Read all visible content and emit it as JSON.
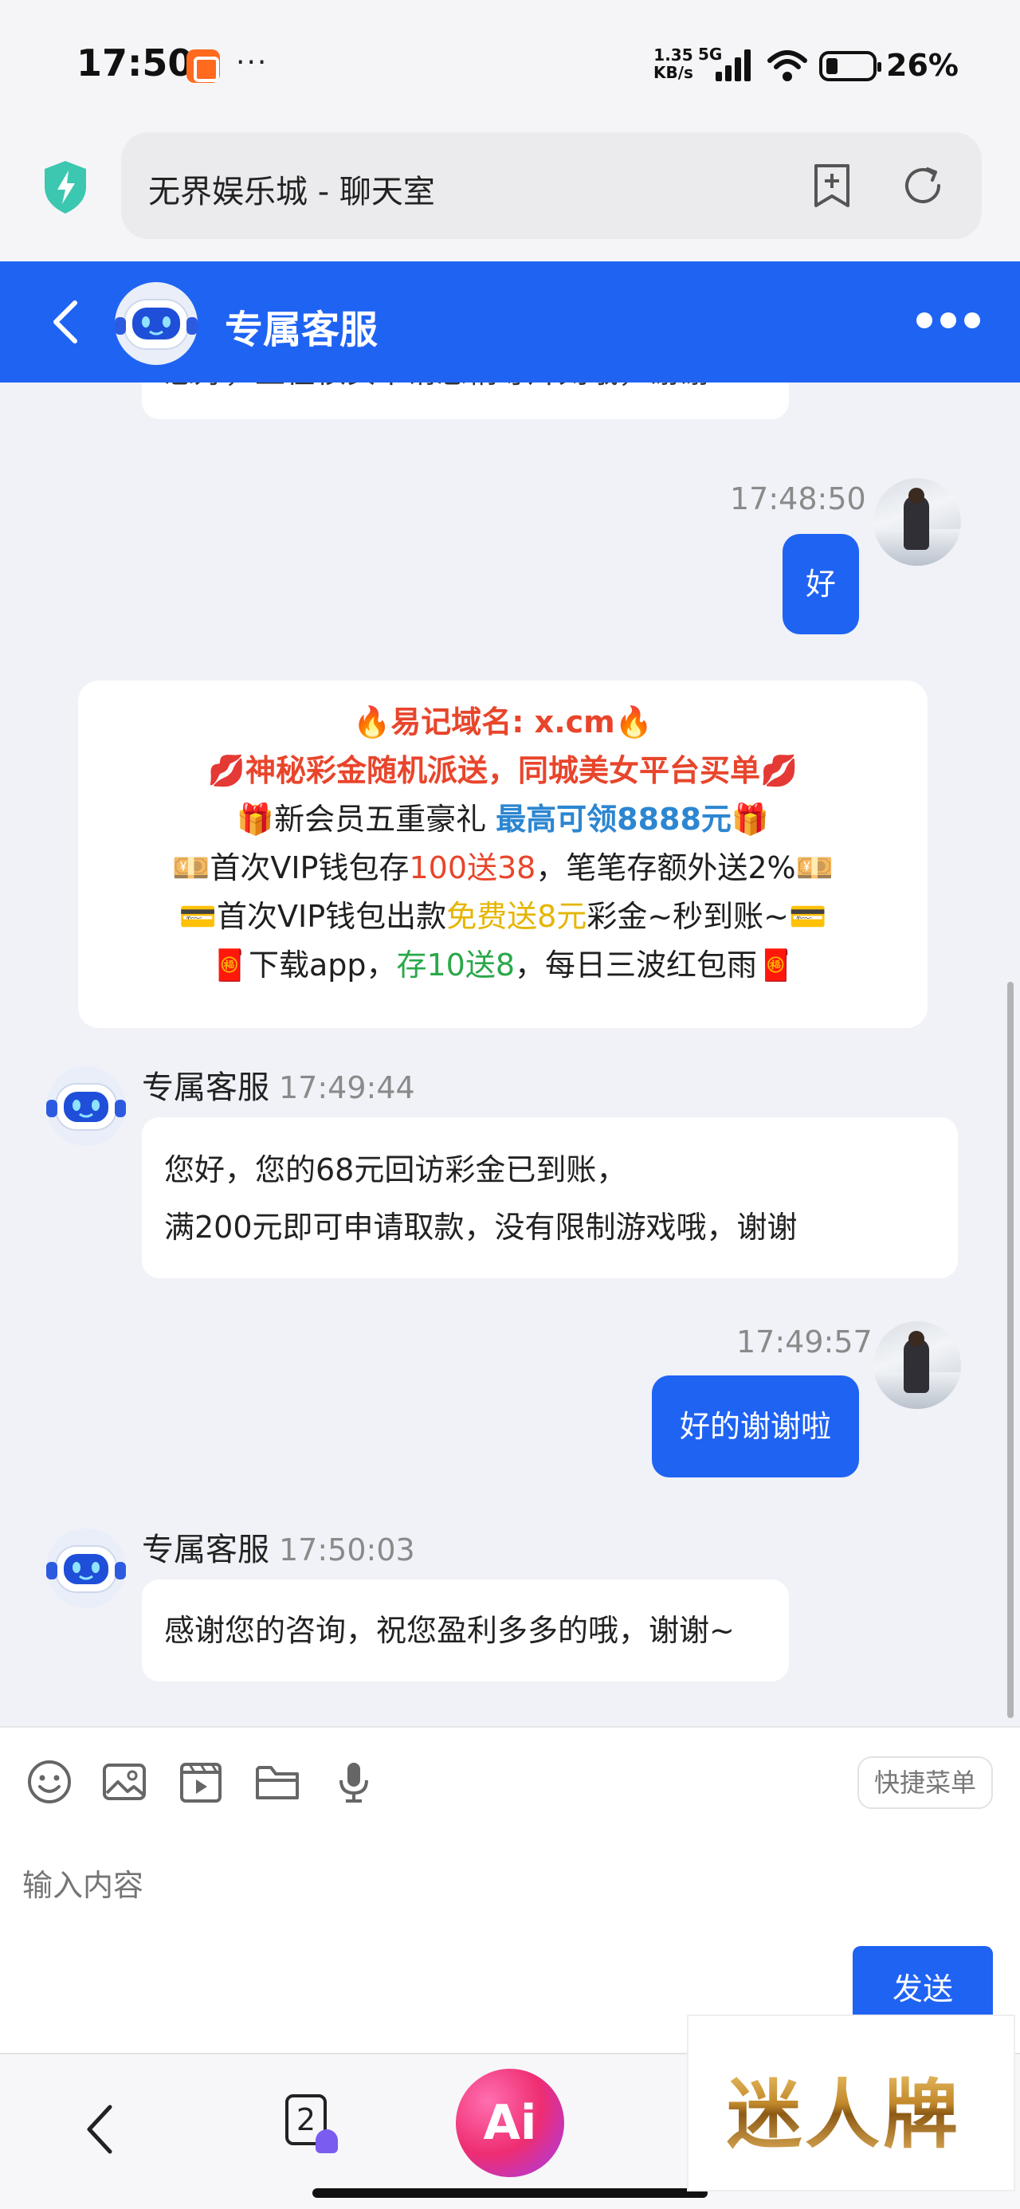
{
  "status_bar": {
    "time": "17:50",
    "dots": "···",
    "net_speed_value": "1.35",
    "net_speed_unit": "KB/s",
    "network": "5G",
    "battery": "26%"
  },
  "browser": {
    "url_title": "无界娱乐城 - 聊天室"
  },
  "header": {
    "title": "专属客服"
  },
  "messages": {
    "truncated_text": "您好，正在核实中请您稍等片刻哦，谢谢~",
    "m1": {
      "time": "17:48:50",
      "text": "好"
    },
    "promo": {
      "line1": "🔥易记域名: x.cm🔥",
      "line2": "💋神秘彩金随机派送，同城美女平台买单💋",
      "line3_a": "🎁新会员五重豪礼 ",
      "line3_b": "最高可领8888元",
      "line3_c": "🎁",
      "line4_a": "💴首次VIP钱包存",
      "line4_b": "100送38",
      "line4_c": "，笔笔存额外送2%💴",
      "line5_a": "💳首次VIP钱包出款",
      "line5_b": "免费送8元",
      "line5_c": "彩金~秒到账~💳",
      "line6_a": "🧧下载app，",
      "line6_b": "存10送8",
      "line6_c": "，每日三波红包雨🧧"
    },
    "m2": {
      "sender": "专属客服",
      "time": "17:49:44",
      "line1": "您好，您的68元回访彩金已到账，",
      "line2": "满200元即可申请取款，没有限制游戏哦，谢谢"
    },
    "m3": {
      "time": "17:49:57",
      "text": "好的谢谢啦"
    },
    "m4": {
      "sender": "专属客服",
      "time": "17:50:03",
      "text": "感谢您的咨询，祝您盈利多多的哦，谢谢~"
    }
  },
  "composer": {
    "quick_menu": "快捷菜单",
    "placeholder": "输入内容",
    "send": "发送"
  },
  "nav": {
    "tab_count": "2",
    "ai_label": "Ai"
  },
  "watermark": "迷人牌",
  "colors": {
    "accent": "#1f63f3",
    "chat_bg": "#f0f2f7",
    "promo_red": "#e8452c",
    "promo_blue": "#2c86d1",
    "promo_yellow": "#e5b500",
    "promo_green": "#2aa84a"
  }
}
